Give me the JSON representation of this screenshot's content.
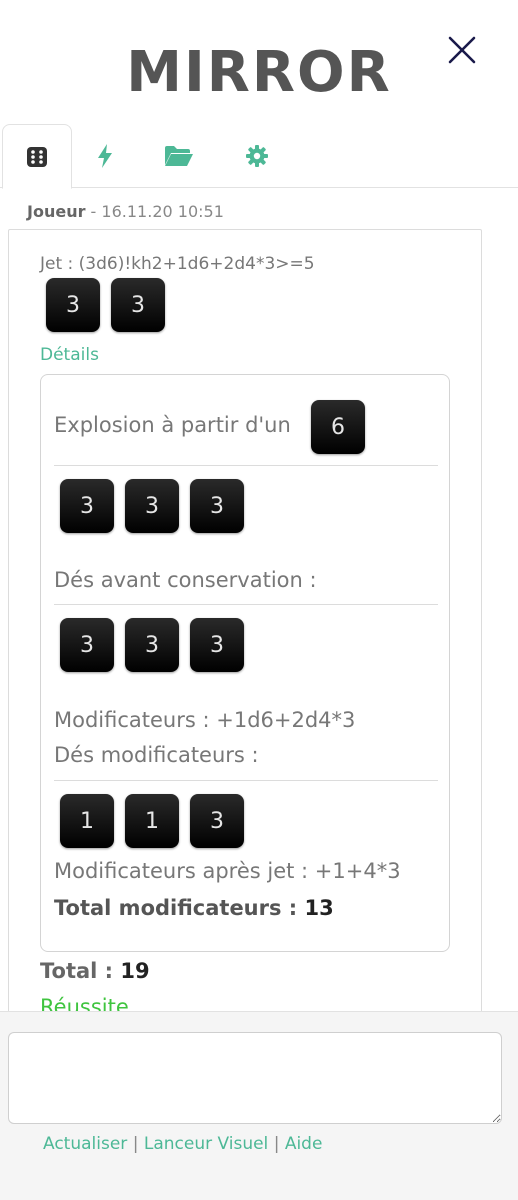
{
  "app": {
    "title": "MIRROR"
  },
  "tabs": [
    {
      "name": "dice",
      "icon": "dice-grid-icon",
      "active": true
    },
    {
      "name": "lightning",
      "icon": "lightning-icon",
      "active": false
    },
    {
      "name": "folder",
      "icon": "folder-open-icon",
      "active": false
    },
    {
      "name": "settings",
      "icon": "gear-icon",
      "active": false
    }
  ],
  "message": {
    "author": "Joueur",
    "separator": " - ",
    "timestamp": "16.11.20 10:51",
    "roll_label": "Jet : (3d6)!kh2+1d6+2d4*3>=5",
    "kept_dice": [
      "3",
      "3"
    ],
    "details_label": "Détails",
    "details": {
      "explosion_label": "Explosion à partir d'un",
      "explosion_die": "6",
      "rolled_dice": [
        "3",
        "3",
        "3"
      ],
      "before_keep_label": "Dés avant conservation :",
      "before_keep_dice": [
        "3",
        "3",
        "3"
      ],
      "modifiers_label": "Modificateurs : +1d6+2d4*3",
      "modifier_dice_label": "Dés modificateurs :",
      "modifier_dice": [
        "1",
        "1",
        "3"
      ],
      "modifiers_after_label": "Modificateurs après jet : +1+4*3",
      "total_modifiers_label": "Total modificateurs :",
      "total_modifiers_value": "13"
    },
    "total_label": "Total :",
    "total_value": "19",
    "result": "Réussite"
  },
  "footer": {
    "input_value": "",
    "links": {
      "refresh": "Actualiser",
      "visual": "Lanceur Visuel",
      "help": "Aide",
      "sep": "|"
    }
  },
  "colors": {
    "accent": "#4db896",
    "success": "#3fc43f",
    "title": "#555555",
    "close": "#1a1a4a"
  }
}
